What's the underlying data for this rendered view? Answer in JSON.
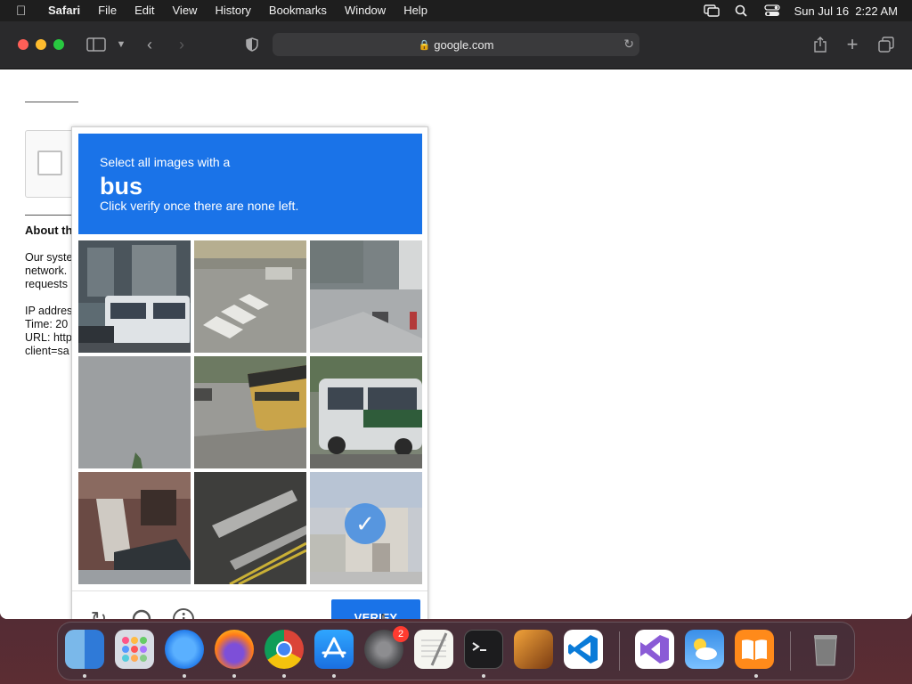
{
  "menubar": {
    "app_name": "Safari",
    "items": [
      "File",
      "Edit",
      "View",
      "History",
      "Bookmarks",
      "Window",
      "Help"
    ],
    "datetime": "Sun Jul 16  2:22 AM"
  },
  "browser": {
    "url": "google.com"
  },
  "background_page": {
    "about_heading": "About th",
    "paragraph_lines": [
      "Our syste",
      "network.",
      "requests"
    ],
    "info_lines": [
      "IP addres",
      "Time: 20",
      "URL: http",
      "client=sa"
    ]
  },
  "captcha": {
    "instruction_line1": "Select all images with a",
    "target": "bus",
    "instruction_line3": "Click verify once there are none left.",
    "verify_label": "VERIFY",
    "selected_tiles": [
      9
    ]
  },
  "dock": {
    "apps": [
      "Finder",
      "Launchpad",
      "Safari",
      "Firefox",
      "Chrome",
      "App Store",
      "System Settings",
      "TextEdit",
      "Terminal",
      "GarageBand",
      "Visual Studio Code",
      "Visual Studio",
      "Weather",
      "Books",
      "Trash"
    ],
    "settings_badge": "2"
  }
}
